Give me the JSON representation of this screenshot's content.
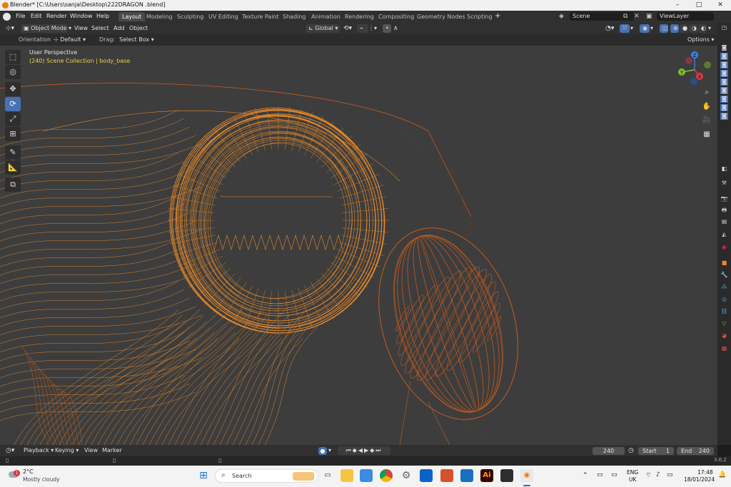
{
  "window": {
    "title": "Blender* [C:\\Users\\sanja\\Desktop\\222DRAGON .blend]",
    "minimize_glyph": "–",
    "maximize_glyph": "□",
    "close_glyph": "✕"
  },
  "menubar": {
    "menus": [
      "File",
      "Edit",
      "Render",
      "Window",
      "Help"
    ],
    "workspaces": [
      "Layout",
      "Modeling",
      "Sculpting",
      "UV Editing",
      "Texture Paint",
      "Shading",
      "Animation",
      "Rendering",
      "Compositing",
      "Geometry Nodes",
      "Scripting"
    ],
    "active_workspace": "Layout",
    "add_workspace": "+",
    "scene": "Scene",
    "view_layer": "ViewLayer"
  },
  "header3d": {
    "mode": "Object Mode",
    "menus": [
      "View",
      "Select",
      "Add",
      "Object"
    ],
    "transform_orientation": "Global"
  },
  "tool_settings": {
    "orientation_label": "Orientation:",
    "orientation_value": "Default",
    "drag_label": "Drag:",
    "drag_value": "Select Box",
    "options_label": "Options"
  },
  "viewport": {
    "view_name": "User Perspective",
    "collection_info": "(240) Scene Collection | body_base",
    "gizmo_axes": [
      "Z",
      "Y",
      "X"
    ],
    "colors": {
      "background": "#3d3d3d",
      "wire_orange": "#e8892a",
      "wire_dark": "#c85a1c",
      "info_yellow": "#e8d24a",
      "axis_x": "#e0384b",
      "axis_y": "#7fbf2e",
      "axis_z": "#3d7fe0"
    }
  },
  "timeline": {
    "menus": [
      "Playback",
      "Keying",
      "View",
      "Marker"
    ],
    "current_frame": "240",
    "start_label": "Start",
    "start_value": "1",
    "end_label": "End",
    "end_value": "240"
  },
  "statusbar": {
    "version": "3.6.2"
  },
  "taskbar": {
    "weather_temp": "2°C",
    "weather_desc": "Mostly cloudy",
    "weather_badge": "1",
    "search_placeholder": "Search",
    "language_1": "ENG",
    "language_2": "UK",
    "time": "17:48",
    "date": "18/01/2024",
    "app_icons": [
      "windows-start-icon",
      "file-explorer-icon",
      "microsoft-store-icon",
      "chrome-icon",
      "settings-icon",
      "outlook-icon",
      "app-red-icon",
      "mail-icon",
      "illustrator-icon",
      "sticky-notes-icon",
      "blender-icon"
    ],
    "illustrator_text": "Ai"
  }
}
